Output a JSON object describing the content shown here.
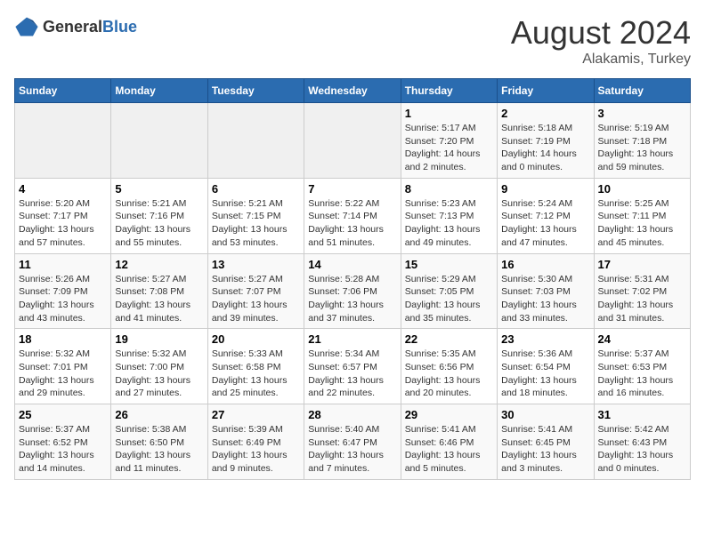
{
  "header": {
    "logo_general": "General",
    "logo_blue": "Blue",
    "main_title": "August 2024",
    "subtitle": "Alakamis, Turkey"
  },
  "days_of_week": [
    "Sunday",
    "Monday",
    "Tuesday",
    "Wednesday",
    "Thursday",
    "Friday",
    "Saturday"
  ],
  "weeks": [
    [
      {
        "day": "",
        "content": ""
      },
      {
        "day": "",
        "content": ""
      },
      {
        "day": "",
        "content": ""
      },
      {
        "day": "",
        "content": ""
      },
      {
        "day": "1",
        "content": "Sunrise: 5:17 AM\nSunset: 7:20 PM\nDaylight: 14 hours\nand 2 minutes."
      },
      {
        "day": "2",
        "content": "Sunrise: 5:18 AM\nSunset: 7:19 PM\nDaylight: 14 hours\nand 0 minutes."
      },
      {
        "day": "3",
        "content": "Sunrise: 5:19 AM\nSunset: 7:18 PM\nDaylight: 13 hours\nand 59 minutes."
      }
    ],
    [
      {
        "day": "4",
        "content": "Sunrise: 5:20 AM\nSunset: 7:17 PM\nDaylight: 13 hours\nand 57 minutes."
      },
      {
        "day": "5",
        "content": "Sunrise: 5:21 AM\nSunset: 7:16 PM\nDaylight: 13 hours\nand 55 minutes."
      },
      {
        "day": "6",
        "content": "Sunrise: 5:21 AM\nSunset: 7:15 PM\nDaylight: 13 hours\nand 53 minutes."
      },
      {
        "day": "7",
        "content": "Sunrise: 5:22 AM\nSunset: 7:14 PM\nDaylight: 13 hours\nand 51 minutes."
      },
      {
        "day": "8",
        "content": "Sunrise: 5:23 AM\nSunset: 7:13 PM\nDaylight: 13 hours\nand 49 minutes."
      },
      {
        "day": "9",
        "content": "Sunrise: 5:24 AM\nSunset: 7:12 PM\nDaylight: 13 hours\nand 47 minutes."
      },
      {
        "day": "10",
        "content": "Sunrise: 5:25 AM\nSunset: 7:11 PM\nDaylight: 13 hours\nand 45 minutes."
      }
    ],
    [
      {
        "day": "11",
        "content": "Sunrise: 5:26 AM\nSunset: 7:09 PM\nDaylight: 13 hours\nand 43 minutes."
      },
      {
        "day": "12",
        "content": "Sunrise: 5:27 AM\nSunset: 7:08 PM\nDaylight: 13 hours\nand 41 minutes."
      },
      {
        "day": "13",
        "content": "Sunrise: 5:27 AM\nSunset: 7:07 PM\nDaylight: 13 hours\nand 39 minutes."
      },
      {
        "day": "14",
        "content": "Sunrise: 5:28 AM\nSunset: 7:06 PM\nDaylight: 13 hours\nand 37 minutes."
      },
      {
        "day": "15",
        "content": "Sunrise: 5:29 AM\nSunset: 7:05 PM\nDaylight: 13 hours\nand 35 minutes."
      },
      {
        "day": "16",
        "content": "Sunrise: 5:30 AM\nSunset: 7:03 PM\nDaylight: 13 hours\nand 33 minutes."
      },
      {
        "day": "17",
        "content": "Sunrise: 5:31 AM\nSunset: 7:02 PM\nDaylight: 13 hours\nand 31 minutes."
      }
    ],
    [
      {
        "day": "18",
        "content": "Sunrise: 5:32 AM\nSunset: 7:01 PM\nDaylight: 13 hours\nand 29 minutes."
      },
      {
        "day": "19",
        "content": "Sunrise: 5:32 AM\nSunset: 7:00 PM\nDaylight: 13 hours\nand 27 minutes."
      },
      {
        "day": "20",
        "content": "Sunrise: 5:33 AM\nSunset: 6:58 PM\nDaylight: 13 hours\nand 25 minutes."
      },
      {
        "day": "21",
        "content": "Sunrise: 5:34 AM\nSunset: 6:57 PM\nDaylight: 13 hours\nand 22 minutes."
      },
      {
        "day": "22",
        "content": "Sunrise: 5:35 AM\nSunset: 6:56 PM\nDaylight: 13 hours\nand 20 minutes."
      },
      {
        "day": "23",
        "content": "Sunrise: 5:36 AM\nSunset: 6:54 PM\nDaylight: 13 hours\nand 18 minutes."
      },
      {
        "day": "24",
        "content": "Sunrise: 5:37 AM\nSunset: 6:53 PM\nDaylight: 13 hours\nand 16 minutes."
      }
    ],
    [
      {
        "day": "25",
        "content": "Sunrise: 5:37 AM\nSunset: 6:52 PM\nDaylight: 13 hours\nand 14 minutes."
      },
      {
        "day": "26",
        "content": "Sunrise: 5:38 AM\nSunset: 6:50 PM\nDaylight: 13 hours\nand 11 minutes."
      },
      {
        "day": "27",
        "content": "Sunrise: 5:39 AM\nSunset: 6:49 PM\nDaylight: 13 hours\nand 9 minutes."
      },
      {
        "day": "28",
        "content": "Sunrise: 5:40 AM\nSunset: 6:47 PM\nDaylight: 13 hours\nand 7 minutes."
      },
      {
        "day": "29",
        "content": "Sunrise: 5:41 AM\nSunset: 6:46 PM\nDaylight: 13 hours\nand 5 minutes."
      },
      {
        "day": "30",
        "content": "Sunrise: 5:41 AM\nSunset: 6:45 PM\nDaylight: 13 hours\nand 3 minutes."
      },
      {
        "day": "31",
        "content": "Sunrise: 5:42 AM\nSunset: 6:43 PM\nDaylight: 13 hours\nand 0 minutes."
      }
    ]
  ]
}
